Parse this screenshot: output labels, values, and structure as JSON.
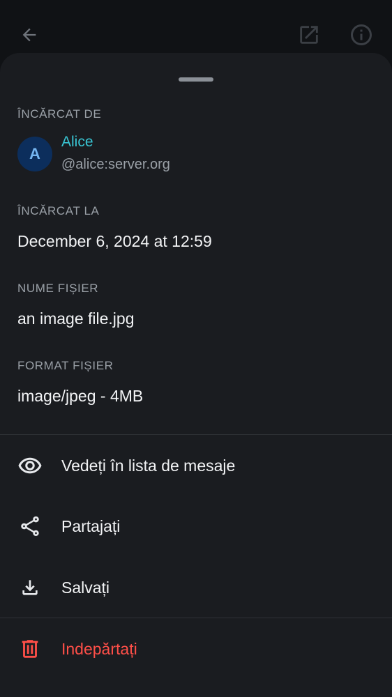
{
  "uploaded_by": {
    "label": "ÎNCĂRCAT DE",
    "avatar_initial": "A",
    "name": "Alice",
    "user_id": "@alice:server.org"
  },
  "uploaded_at": {
    "label": "ÎNCĂRCAT LA",
    "value": "December 6, 2024 at 12:59"
  },
  "file_name": {
    "label": "NUME FIȘIER",
    "value": "an image file.jpg"
  },
  "file_format": {
    "label": "FORMAT FIȘIER",
    "value": "image/jpeg - 4MB"
  },
  "actions": [
    {
      "label": "Vedeți în lista de mesaje",
      "icon": "eye-icon"
    },
    {
      "label": "Partajați",
      "icon": "share-icon"
    },
    {
      "label": "Salvați",
      "icon": "download-icon"
    },
    {
      "label": "Indepărtați",
      "icon": "trash-icon"
    }
  ],
  "colors": {
    "background": "#101215",
    "sheet": "#1a1c20",
    "accent_name": "#39c6d4",
    "danger": "#ff4f48",
    "avatar_bg": "#0c2e5c"
  }
}
